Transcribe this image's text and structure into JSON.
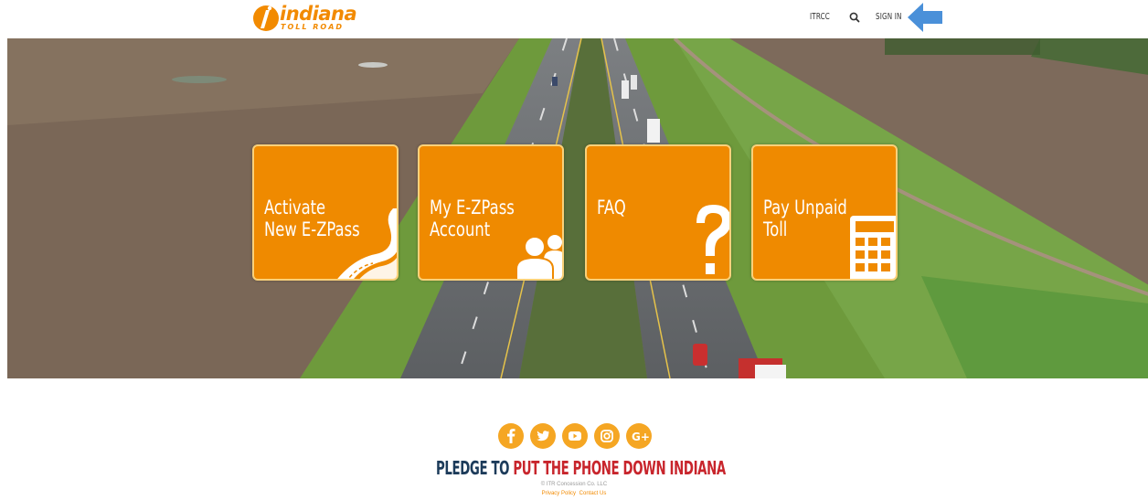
{
  "header": {
    "logo": {
      "name": "indiana",
      "tagline": "TOLL ROAD"
    },
    "nav": {
      "itrcc": "ITRCC",
      "sign_in": "SIGN IN"
    },
    "icons": {
      "search": "search-icon",
      "annotation_arrow": "arrow-left-icon"
    }
  },
  "tiles": [
    {
      "label": "Activate\nNew E-ZPass",
      "icon": "road-icon"
    },
    {
      "label": "My E-ZPass\nAccount",
      "icon": "users-icon"
    },
    {
      "label": "FAQ",
      "icon": "question-mark-icon"
    },
    {
      "label": "Pay Unpaid\nToll",
      "icon": "calculator-icon"
    }
  ],
  "footer": {
    "social": [
      "facebook-icon",
      "twitter-icon",
      "youtube-icon",
      "instagram-icon",
      "google-plus-icon"
    ],
    "pledge_prefix": "PLEDGE TO",
    "pledge_highlight": "PUT THE PHONE DOWN INDIANA",
    "copyright": "© ITR Concession Co. LLC",
    "links": [
      "Privacy Policy",
      "Contact Us"
    ]
  },
  "colors": {
    "brand_orange": "#ef8a00",
    "tile_border": "#f9d17a",
    "social_bg": "#f5a623",
    "pledge_blue": "#1c3b5a",
    "pledge_red": "#c8252c",
    "arrow_blue": "#4a90d9"
  }
}
